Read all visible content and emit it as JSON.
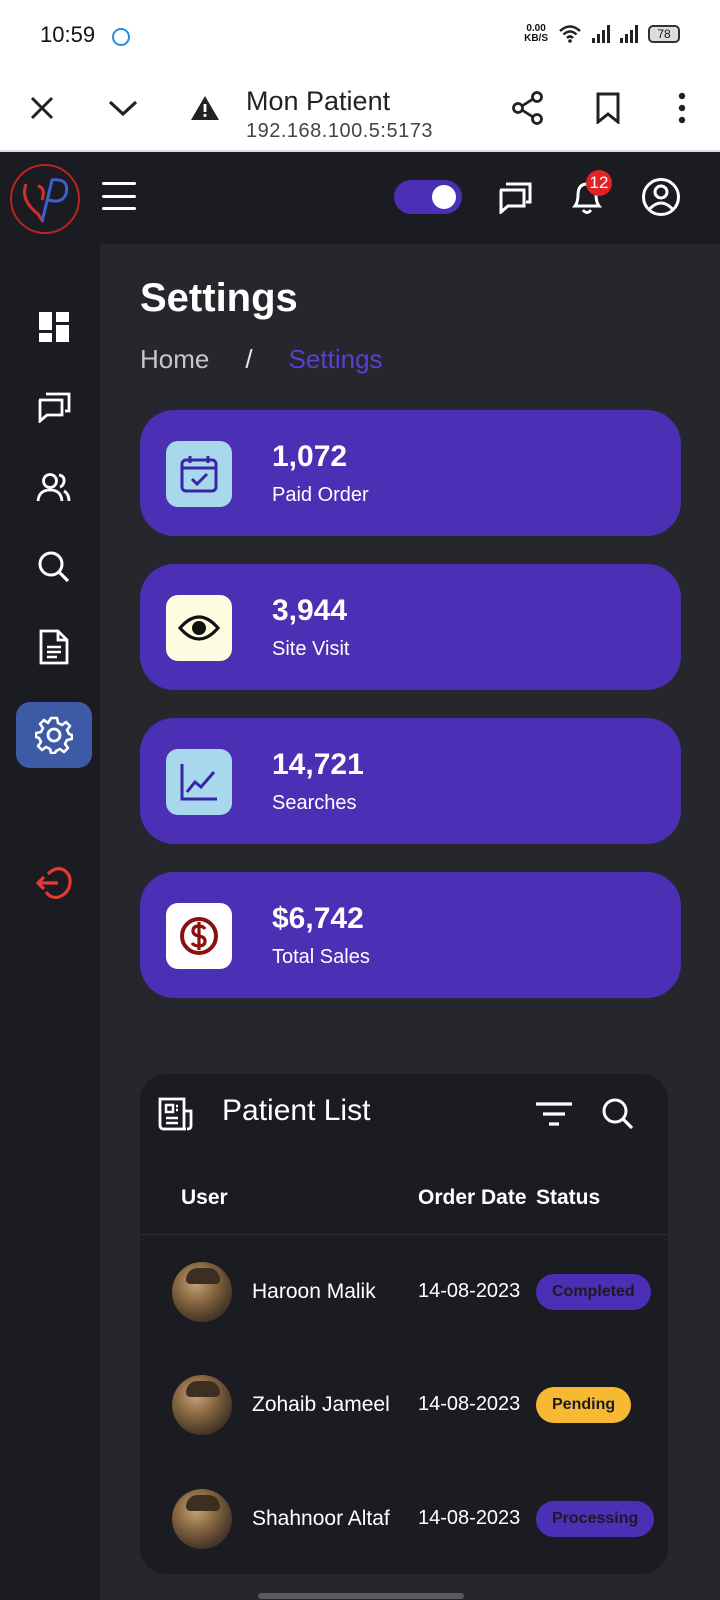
{
  "status_bar": {
    "time": "10:59",
    "net_speed": "0.00",
    "net_unit": "KB/S",
    "battery": "78"
  },
  "browser": {
    "title": "Mon Patient",
    "url": "192.168.100.5:5173"
  },
  "header": {
    "notification_count": "12"
  },
  "page": {
    "title": "Settings"
  },
  "breadcrumb": {
    "home": "Home",
    "separator": "/",
    "current": "Settings"
  },
  "stats": [
    {
      "value": "1,072",
      "label": "Paid Order",
      "icon": "calendar-check-icon",
      "icon_bg": "#a7d8ec"
    },
    {
      "value": "3,944",
      "label": "Site Visit",
      "icon": "eye-icon",
      "icon_bg": "#fdfbe0"
    },
    {
      "value": "14,721",
      "label": "Searches",
      "icon": "chart-line-icon",
      "icon_bg": "#a7d8ec"
    },
    {
      "value": "$6,742",
      "label": "Total Sales",
      "icon": "dollar-icon",
      "icon_bg": "#ffffff"
    }
  ],
  "patient_list": {
    "title": "Patient List",
    "columns": {
      "user": "User",
      "order_date": "Order Date",
      "status": "Status"
    },
    "rows": [
      {
        "name": "Haroon Malik",
        "date": "14-08-2023",
        "status": "Completed",
        "status_bg": "#4b2fb4",
        "status_fg": "#1b1c21"
      },
      {
        "name": "Zohaib Jameel",
        "date": "14-08-2023",
        "status": "Pending",
        "status_bg": "#f6b931",
        "status_fg": "#1b1c21"
      },
      {
        "name": "Shahnoor Altaf",
        "date": "14-08-2023",
        "status": "Processing",
        "status_bg": "#4b2fb4",
        "status_fg": "#1b1c21"
      }
    ]
  },
  "colors": {
    "accent": "#4b2fb4",
    "sidebar_active": "#3c5aa6",
    "badge": "#e02424",
    "logout": "#e53935"
  }
}
